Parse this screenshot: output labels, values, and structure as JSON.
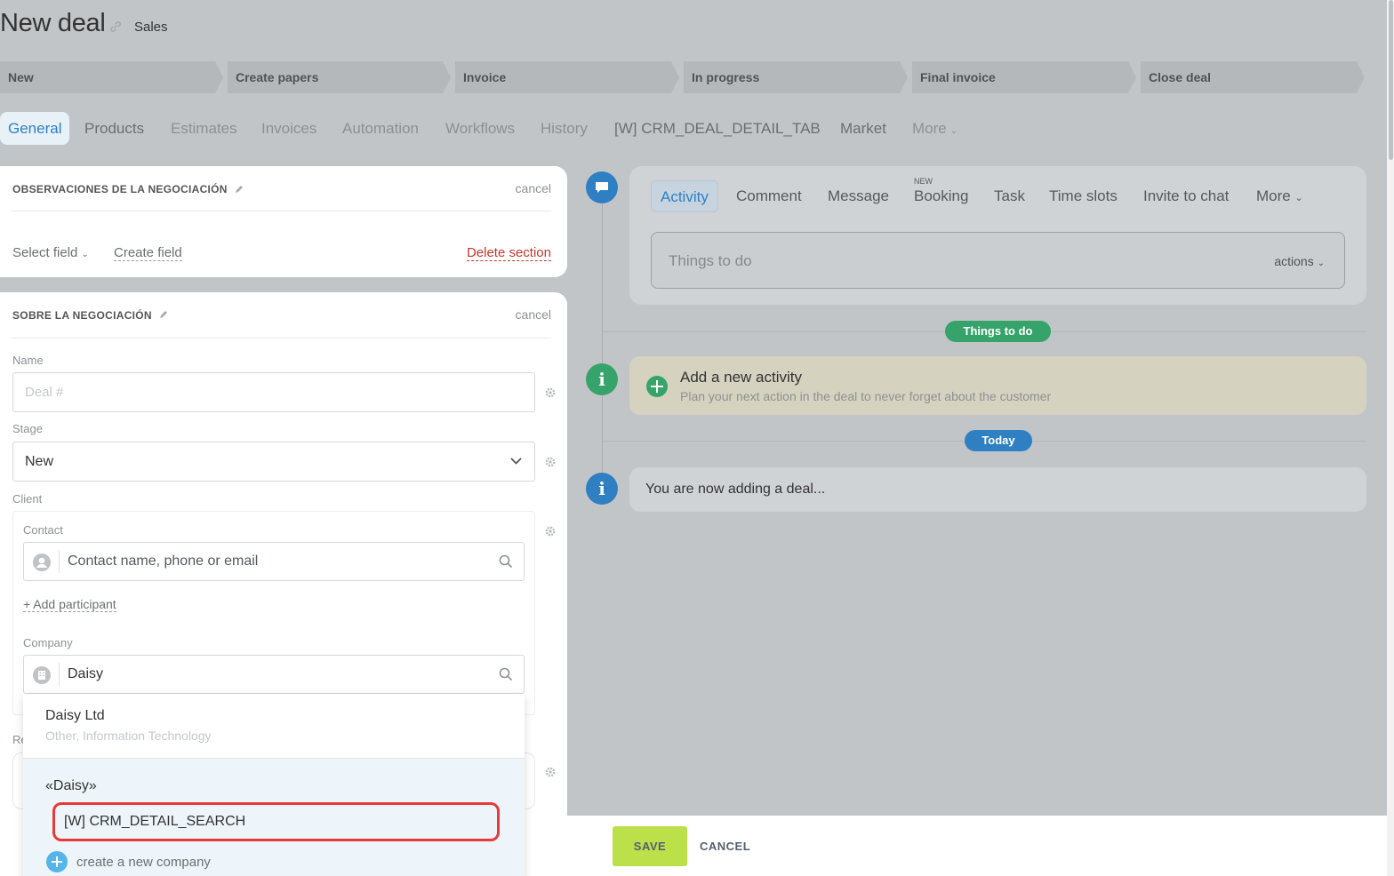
{
  "header": {
    "title": "New deal",
    "subtitle": "Sales"
  },
  "stages": [
    "New",
    "Create papers",
    "Invoice",
    "In progress",
    "Final invoice",
    "Close deal"
  ],
  "tabs": [
    "General",
    "Products",
    "Estimates",
    "Invoices",
    "Automation",
    "Workflows",
    "History",
    "[W] CRM_DEAL_DETAIL_TAB",
    "Market",
    "More"
  ],
  "section1": {
    "title": "OBSERVACIONES DE LA NEGOCIACIÓN",
    "cancel": "cancel",
    "select_field": "Select field",
    "create_field": "Create field",
    "delete_section": "Delete section"
  },
  "section2": {
    "title": "SOBRE LA NEGOCIACIÓN",
    "cancel": "cancel",
    "name_label": "Name",
    "name_placeholder": "Deal #",
    "stage_label": "Stage",
    "stage_value": "New",
    "client_label": "Client",
    "contact_label": "Contact",
    "contact_placeholder": "Contact name, phone or email",
    "add_participant": "+ Add participant",
    "company_label": "Company",
    "company_value": "Daisy",
    "partial_label": "Re"
  },
  "dropdown": {
    "result_name": "Daisy Ltd",
    "result_meta": "Other, Information Technology",
    "query": "«Daisy»",
    "search_item": "[W] CRM_DETAIL_SEARCH",
    "create_new": "create a new company"
  },
  "activity": {
    "tabs": [
      "Activity",
      "Comment",
      "Message",
      "Booking",
      "Task",
      "Time slots",
      "Invite to chat",
      "More"
    ],
    "new_badge": "NEW",
    "todo_placeholder": "Things to do",
    "actions": "actions"
  },
  "timeline": {
    "things_to_do_pill": "Things to do",
    "add_title": "Add a new activity",
    "add_desc": "Plan your next action in the deal to never forget about the customer",
    "today_pill": "Today",
    "now_adding": "You are now adding a deal..."
  },
  "footer": {
    "save": "SAVE",
    "cancel": "CANCEL"
  },
  "colors": {
    "accent": "#2d7fc5",
    "save": "#bbe04a",
    "green": "#3aa76d",
    "highlight": "#e8393a"
  }
}
